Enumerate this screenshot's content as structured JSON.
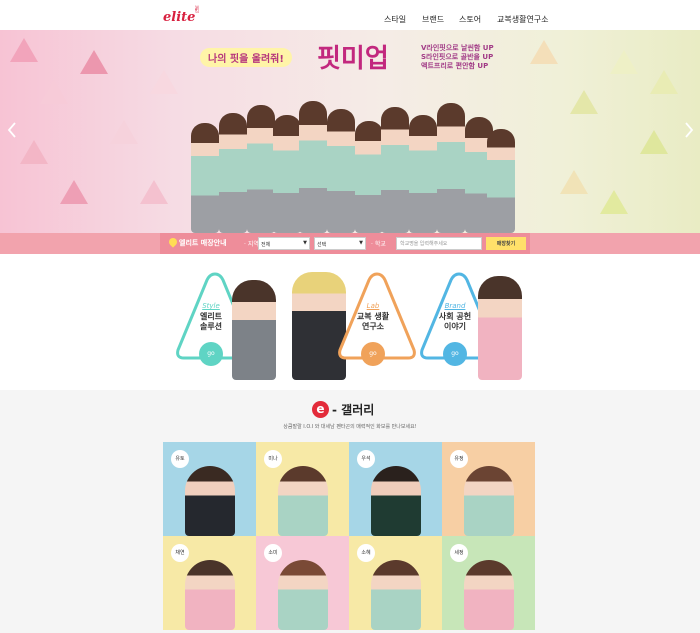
{
  "header": {
    "logo": "elite",
    "nav": [
      "스타일",
      "브랜드",
      "스토어",
      "교복생활연구소"
    ]
  },
  "banner": {
    "headline_small": "나의 핏을 올려줘!",
    "headline_big": "핏미업",
    "copy_lines": [
      "V라인핏으로 날씬함 UP",
      "S라인핏으로 골반을 UP",
      "액트프리로 편안함 UP"
    ],
    "prev_icon": "chevron-left-icon",
    "next_icon": "chevron-right-icon",
    "slide_count": 4,
    "active_slide": 1
  },
  "store_search": {
    "title": "엘리트 매장안내",
    "region_label": "· 지역",
    "region_value": "전체",
    "district_value": "선택",
    "school_label": "· 학교",
    "school_placeholder": "학교명을 입력해주세요",
    "button": "매장찾기"
  },
  "promo": [
    {
      "eng": "Style",
      "kor": [
        "엘리트",
        "솔루션"
      ],
      "go": "go",
      "color": "#5fd4c4"
    },
    {
      "eng": "Lab",
      "kor": [
        "교복 생활",
        "연구소"
      ],
      "go": "go",
      "color": "#f0a25a"
    },
    {
      "eng": "Brand",
      "kor": [
        "사회 공헌",
        "이야기"
      ],
      "go": "go",
      "color": "#52b6e3"
    }
  ],
  "gallery": {
    "title": "갤러리",
    "e_mark": "e",
    "subtitle": "상큼발랄 I.O.I 와 대세남 펜타곤의 매력적인 화보를 만나보세요!",
    "tiles": [
      {
        "name": "유토",
        "bg": "#a6d6e7"
      },
      {
        "name": "미나",
        "bg": "#f7e9a6"
      },
      {
        "name": "우석",
        "bg": "#a6d6e7"
      },
      {
        "name": "유정",
        "bg": "#f7cfa4"
      },
      {
        "name": "채연",
        "bg": "#f7e9a6"
      },
      {
        "name": "소미",
        "bg": "#f7c8d6"
      },
      {
        "name": "소혜",
        "bg": "#f7e9a6"
      },
      {
        "name": "세정",
        "bg": "#c7e6b8"
      }
    ]
  }
}
